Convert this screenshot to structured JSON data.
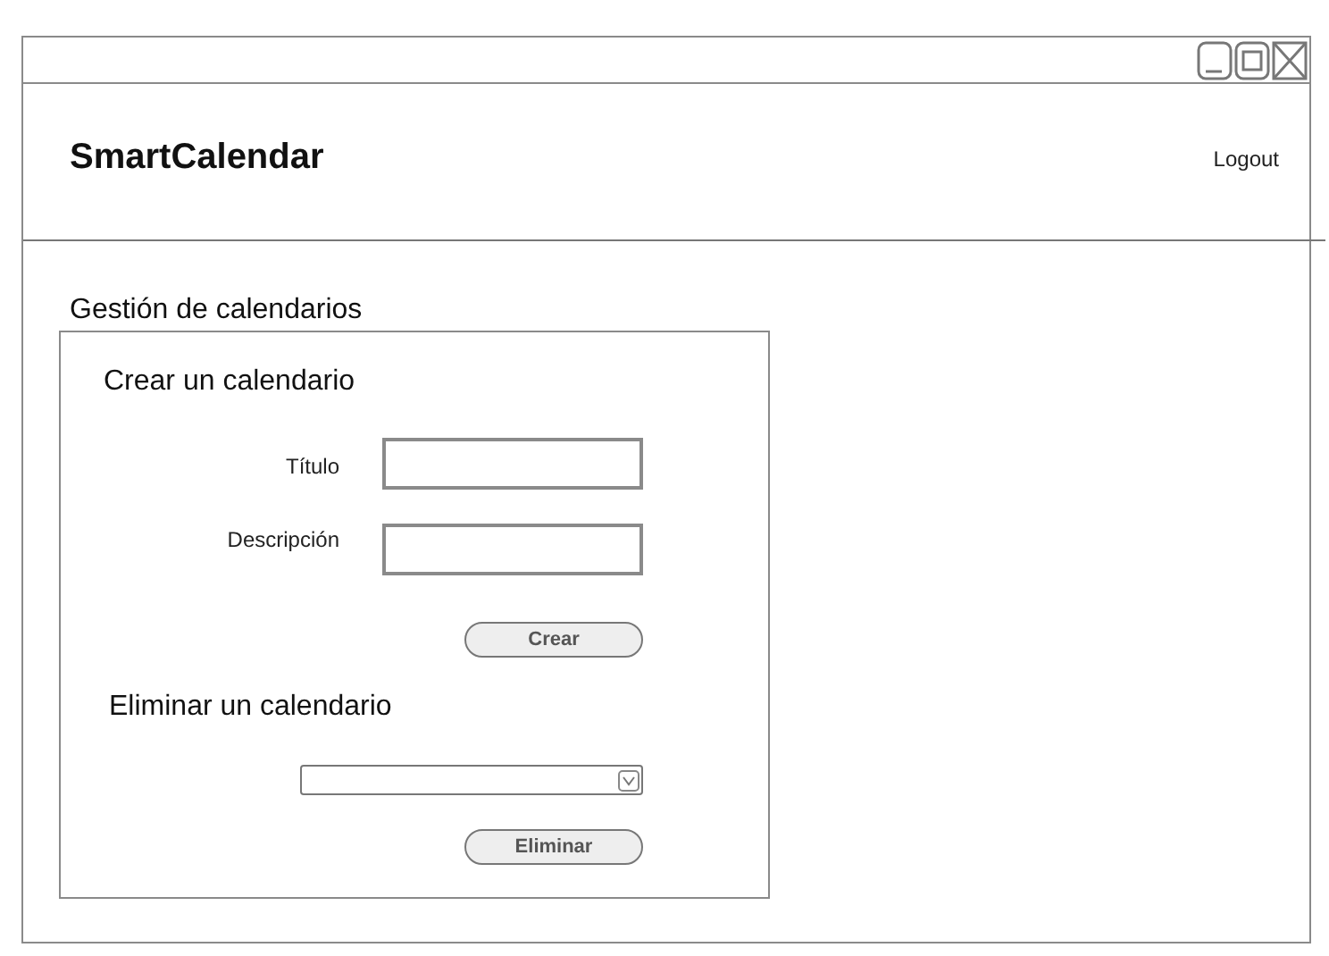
{
  "app": {
    "title": "SmartCalendar",
    "logout": "Logout"
  },
  "section": {
    "title": "Gestión de calendarios"
  },
  "create": {
    "heading": "Crear un calendario",
    "fields": [
      {
        "label": "Título"
      },
      {
        "label": "Descripción"
      }
    ],
    "button": "Crear"
  },
  "delete": {
    "heading": "Eliminar un calendario",
    "button": "Eliminar"
  }
}
